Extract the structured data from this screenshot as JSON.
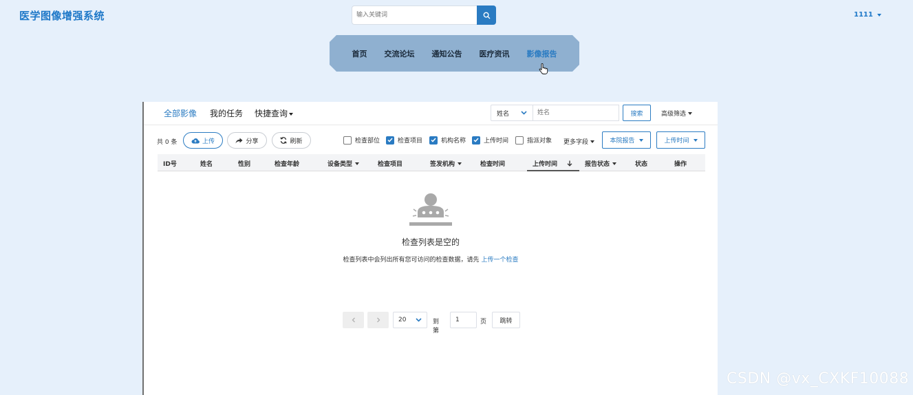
{
  "header": {
    "brand": "医学图像增强系统",
    "search_placeholder": "输入关键词",
    "search_icon": "search-icon",
    "user": "1111"
  },
  "nav": {
    "items": [
      "首页",
      "交流论坛",
      "通知公告",
      "医疗资讯",
      "影像报告"
    ],
    "active": "影像报告"
  },
  "tabs": [
    "全部影像",
    "我的任务",
    "快捷查询"
  ],
  "filter": {
    "field": "姓名",
    "input_placeholder": "姓名",
    "search_label": "搜索",
    "advanced_label": "高级筛选"
  },
  "toolbar": {
    "count": "共 0 条",
    "upload": "上传",
    "share": "分享",
    "refresh": "刷新",
    "columns": [
      {
        "label": "检查部位",
        "checked": false
      },
      {
        "label": "检查项目",
        "checked": true
      },
      {
        "label": "机构名称",
        "checked": true
      },
      {
        "label": "上传时间",
        "checked": true
      },
      {
        "label": "指派对象",
        "checked": false
      }
    ],
    "more_fields": "更多字段",
    "report_filter": "本院报告",
    "time_filter": "上传时间"
  },
  "table": {
    "headers": [
      "ID号",
      "姓名",
      "性别",
      "检查年龄",
      "设备类型",
      "检查项目",
      "签发机构",
      "检查时间",
      "上传时间",
      "报告状态",
      "状态",
      "操作"
    ]
  },
  "empty": {
    "title": "检查列表是空的",
    "desc": "检查列表中会列出所有您可访问的检查数据，请先",
    "link": "上传一个检查"
  },
  "pagination": {
    "page_size": "20",
    "goto_label": "到第",
    "page_value": "1",
    "page_unit": "页",
    "jump_label": "跳转"
  },
  "watermark": "CSDN @vx_CXKF10088",
  "colors": {
    "accent": "#2a7bc2",
    "nav_bg": "#8fb0d0",
    "page_bg": "#e6f0fb"
  }
}
